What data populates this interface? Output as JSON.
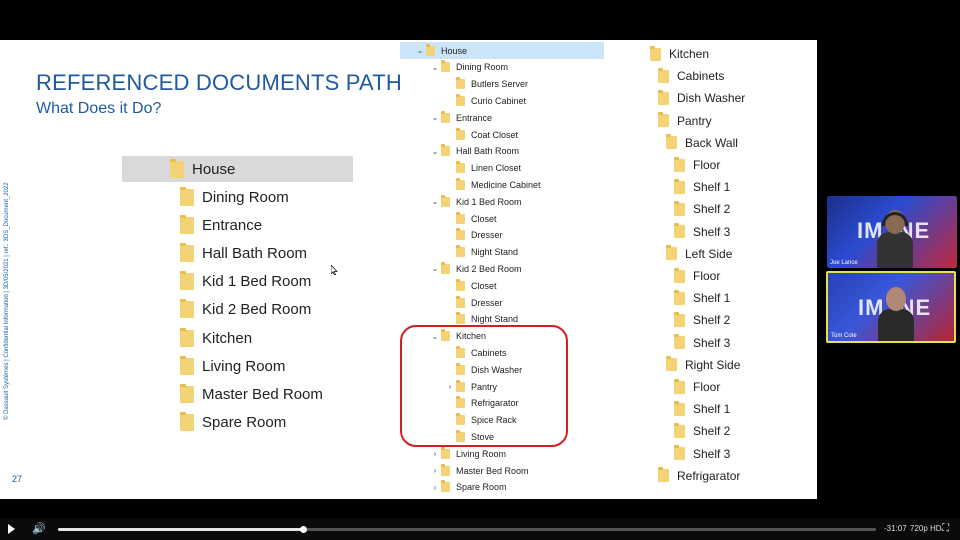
{
  "slide": {
    "title": "REFERENCED DOCUMENTS PATH",
    "subtitle": "What Does it Do?",
    "side_copy": "© Dassault Systèmes | Confidential Information | 3D/05/2021 | ref.: 3DS_Document_2022",
    "number": "27"
  },
  "left_tree": {
    "root": "House",
    "children": [
      "Dining Room",
      "Entrance",
      "Hall Bath Room",
      "Kid 1 Bed Room",
      "Kid 2 Bed Room",
      "Kitchen",
      "Living Room",
      "Master Bed Room",
      "Spare Room"
    ]
  },
  "middle_tree": {
    "rows": [
      {
        "label": "House",
        "level": 0,
        "chevron": "⌄"
      },
      {
        "label": "Dining Room",
        "level": 1,
        "chevron": "⌄"
      },
      {
        "label": "Butlers Server",
        "level": 2,
        "chevron": ""
      },
      {
        "label": "Curio Cabinet",
        "level": 2,
        "chevron": ""
      },
      {
        "label": "Entrance",
        "level": 1,
        "chevron": "⌄"
      },
      {
        "label": "Coat Closet",
        "level": 2,
        "chevron": ""
      },
      {
        "label": "Hall Bath Room",
        "level": 1,
        "chevron": "⌄"
      },
      {
        "label": "Linen Closet",
        "level": 2,
        "chevron": ""
      },
      {
        "label": "Medicine Cabinet",
        "level": 2,
        "chevron": ""
      },
      {
        "label": "Kid 1 Bed Room",
        "level": 1,
        "chevron": "⌄"
      },
      {
        "label": "Closet",
        "level": 2,
        "chevron": ""
      },
      {
        "label": "Dresser",
        "level": 2,
        "chevron": ""
      },
      {
        "label": "Night Stand",
        "level": 2,
        "chevron": ""
      },
      {
        "label": "Kid 2 Bed Room",
        "level": 1,
        "chevron": "⌄"
      },
      {
        "label": "Closet",
        "level": 2,
        "chevron": ""
      },
      {
        "label": "Dresser",
        "level": 2,
        "chevron": ""
      },
      {
        "label": "Night Stand",
        "level": 2,
        "chevron": ""
      },
      {
        "label": "Kitchen",
        "level": 1,
        "chevron": "⌄"
      },
      {
        "label": "Cabinets",
        "level": 2,
        "chevron": ""
      },
      {
        "label": "Dish Washer",
        "level": 2,
        "chevron": ""
      },
      {
        "label": "Pantry",
        "level": 2,
        "chevron": "›"
      },
      {
        "label": "Refrigarator",
        "level": 2,
        "chevron": ""
      },
      {
        "label": "Spice Rack",
        "level": 2,
        "chevron": ""
      },
      {
        "label": "Stove",
        "level": 2,
        "chevron": ""
      },
      {
        "label": "Living Room",
        "level": 1,
        "chevron": "›"
      },
      {
        "label": "Master Bed Room",
        "level": 1,
        "chevron": "›"
      },
      {
        "label": "Spare Room",
        "level": 1,
        "chevron": "›"
      }
    ]
  },
  "right_tree": {
    "rows": [
      {
        "label": "Kitchen",
        "level": 0
      },
      {
        "label": "Cabinets",
        "level": 1
      },
      {
        "label": "Dish Washer",
        "level": 1
      },
      {
        "label": "Pantry",
        "level": 1
      },
      {
        "label": "Back Wall",
        "level": 2
      },
      {
        "label": "Floor",
        "level": 3
      },
      {
        "label": "Shelf 1",
        "level": 3
      },
      {
        "label": "Shelf 2",
        "level": 3
      },
      {
        "label": "Shelf 3",
        "level": 3
      },
      {
        "label": "Left Side",
        "level": 2
      },
      {
        "label": "Floor",
        "level": 3
      },
      {
        "label": "Shelf 1",
        "level": 3
      },
      {
        "label": "Shelf 2",
        "level": 3
      },
      {
        "label": "Shelf 3",
        "level": 3
      },
      {
        "label": "Right Side",
        "level": 2
      },
      {
        "label": "Floor",
        "level": 3
      },
      {
        "label": "Shelf 1",
        "level": 3
      },
      {
        "label": "Shelf 2",
        "level": 3
      },
      {
        "label": "Shelf 3",
        "level": 3
      },
      {
        "label": "Refrigarator",
        "level": 1
      }
    ]
  },
  "participants": [
    {
      "name": "Joe Lance",
      "brand": "IM  INE"
    },
    {
      "name": "Tom Cote",
      "brand": "IM  INE"
    }
  ],
  "player": {
    "progress_fraction": 0.3,
    "time_remaining": "-31:07",
    "quality": "720p HD",
    "play_icon": "play-icon",
    "volume_icon": "volume-icon",
    "fullscreen_icon": "fullscreen-icon"
  },
  "colors": {
    "title_blue": "#1f5aa0",
    "highlight_red": "#d21f24",
    "folder_yellow": "#f4d276",
    "selection_blue": "#cce4f7"
  }
}
